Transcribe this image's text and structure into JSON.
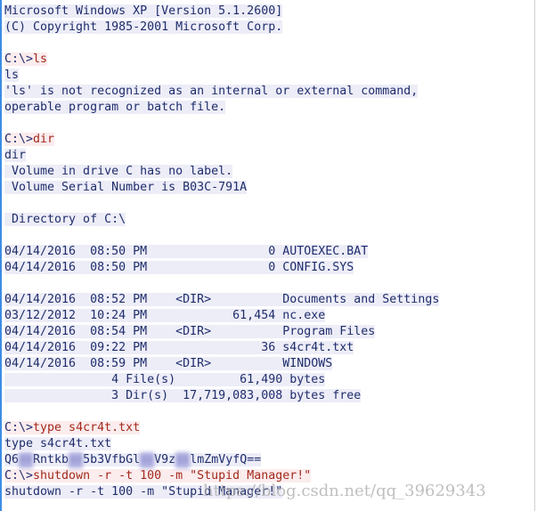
{
  "colors": {
    "text": "#1f2d6b",
    "command": "#a3291a",
    "output_bg": "#ededf8",
    "command_bg": "#fbecee",
    "left_border": "#3b8de3"
  },
  "lines": [
    {
      "type": "out",
      "text": "Microsoft Windows XP [Version 5.1.2600]"
    },
    {
      "type": "out",
      "text": "(C) Copyright 1985-2001 Microsoft Corp."
    },
    {
      "type": "blank",
      "text": ""
    },
    {
      "type": "cmd",
      "prompt": "C:\\>",
      "command": "ls"
    },
    {
      "type": "out",
      "text": "ls"
    },
    {
      "type": "out",
      "text": "'ls' is not recognized as an internal or external command,"
    },
    {
      "type": "out",
      "text": "operable program or batch file."
    },
    {
      "type": "blank",
      "text": ""
    },
    {
      "type": "cmd",
      "prompt": "C:\\>",
      "command": "dir"
    },
    {
      "type": "out",
      "text": "dir"
    },
    {
      "type": "out",
      "text": " Volume in drive C has no label."
    },
    {
      "type": "out",
      "text": " Volume Serial Number is B03C-791A"
    },
    {
      "type": "blank",
      "text": ""
    },
    {
      "type": "out",
      "text": " Directory of C:\\"
    },
    {
      "type": "blank",
      "text": ""
    },
    {
      "type": "out",
      "text": "04/14/2016  08:50 PM                 0 AUTOEXEC.BAT"
    },
    {
      "type": "out",
      "text": "04/14/2016  08:50 PM                 0 CONFIG.SYS"
    },
    {
      "type": "blank",
      "text": ""
    },
    {
      "type": "out",
      "text": "04/14/2016  08:52 PM    <DIR>          Documents and Settings"
    },
    {
      "type": "out",
      "text": "03/12/2012  10:24 PM            61,454 nc.exe"
    },
    {
      "type": "out",
      "text": "04/14/2016  08:54 PM    <DIR>          Program Files"
    },
    {
      "type": "out",
      "text": "04/14/2016  09:22 PM                36 s4cr4t.txt"
    },
    {
      "type": "out",
      "text": "04/14/2016  08:59 PM    <DIR>          WINDOWS"
    },
    {
      "type": "out",
      "text": "               4 File(s)         61,490 bytes"
    },
    {
      "type": "out",
      "text": "               3 Dir(s)  17,719,083,008 bytes free"
    },
    {
      "type": "blank",
      "text": ""
    },
    {
      "type": "cmd",
      "prompt": "C:\\>",
      "command": "type s4cr4t.txt"
    },
    {
      "type": "out",
      "text": "type s4cr4t.txt"
    },
    {
      "type": "secret",
      "segments": [
        {
          "text": "Q6",
          "blur": false
        },
        {
          "text": "xx",
          "blur": true
        },
        {
          "text": "Rntkb",
          "blur": false
        },
        {
          "text": "xx",
          "blur": true
        },
        {
          "text": "5b3VfbGl",
          "blur": false
        },
        {
          "text": "xx",
          "blur": true
        },
        {
          "text": "V9z",
          "blur": false
        },
        {
          "text": "xx",
          "blur": true
        },
        {
          "text": "lmZmVyfQ==",
          "blur": false
        }
      ]
    },
    {
      "type": "cmd",
      "prompt": "C:\\>",
      "command": "shutdown -r -t 100 -m \"Stupid Manager!\""
    },
    {
      "type": "out",
      "text": "shutdown -r -t 100 -m \"Stupid Manager!\""
    }
  ],
  "watermark": "https://blog.csdn.net/qq_39629343"
}
